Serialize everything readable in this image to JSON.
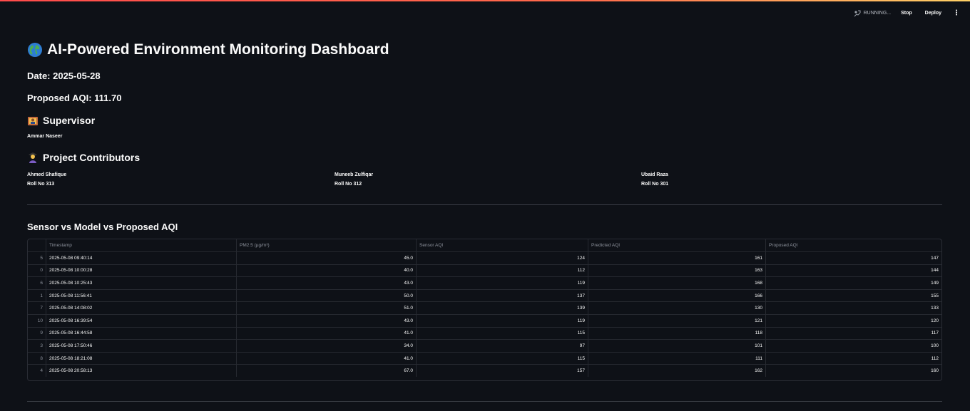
{
  "toolbar": {
    "status": "RUNNING...",
    "stop": "Stop",
    "deploy": "Deploy",
    "menu": "⋮"
  },
  "page": {
    "title": "AI-Powered Environment Monitoring Dashboard",
    "date": "Date: 2025-05-28",
    "proposed_aqi": "Proposed AQI: 111.70"
  },
  "supervisor": {
    "heading": "Supervisor",
    "name": "Ammar Naseer"
  },
  "contributors": {
    "heading": "Project Contributors",
    "people": [
      {
        "name": "Ahmed Shafique",
        "roll": "Roll No 313"
      },
      {
        "name": "Muneeb Zulfiqar",
        "roll": "Roll No 312"
      },
      {
        "name": "Ubaid Raza",
        "roll": "Roll No 301"
      }
    ]
  },
  "table": {
    "heading": "Sensor vs Model vs Proposed AQI",
    "columns": [
      "",
      "Timestamp",
      "PM2.5 (µg/m³)",
      "Sensor AQI",
      "Predicted AQI",
      "Proposed AQI"
    ],
    "rows": [
      [
        "5",
        "2025-05-08 09:40:14",
        "45.0",
        "124",
        "161",
        "147"
      ],
      [
        "0",
        "2025-05-08 10:00:28",
        "40.0",
        "112",
        "163",
        "144"
      ],
      [
        "6",
        "2025-05-08 10:25:43",
        "43.0",
        "119",
        "168",
        "149"
      ],
      [
        "1",
        "2025-05-08 11:56:41",
        "50.0",
        "137",
        "166",
        "155"
      ],
      [
        "7",
        "2025-05-08 14:08:02",
        "51.0",
        "139",
        "130",
        "133"
      ],
      [
        "10",
        "2025-05-08 16:39:54",
        "43.0",
        "119",
        "121",
        "120"
      ],
      [
        "9",
        "2025-05-08 16:44:58",
        "41.0",
        "115",
        "118",
        "117"
      ],
      [
        "3",
        "2025-05-08 17:50:46",
        "34.0",
        "97",
        "101",
        "100"
      ],
      [
        "8",
        "2025-05-08 18:21:08",
        "41.0",
        "115",
        "111",
        "112"
      ],
      [
        "4",
        "2025-05-08 20:58:13",
        "67.0",
        "157",
        "162",
        "160"
      ]
    ]
  },
  "icons": {
    "title": "globe-icon",
    "supervisor": "supervisor-icon",
    "contributors": "student-icon",
    "status": "running-icon"
  }
}
